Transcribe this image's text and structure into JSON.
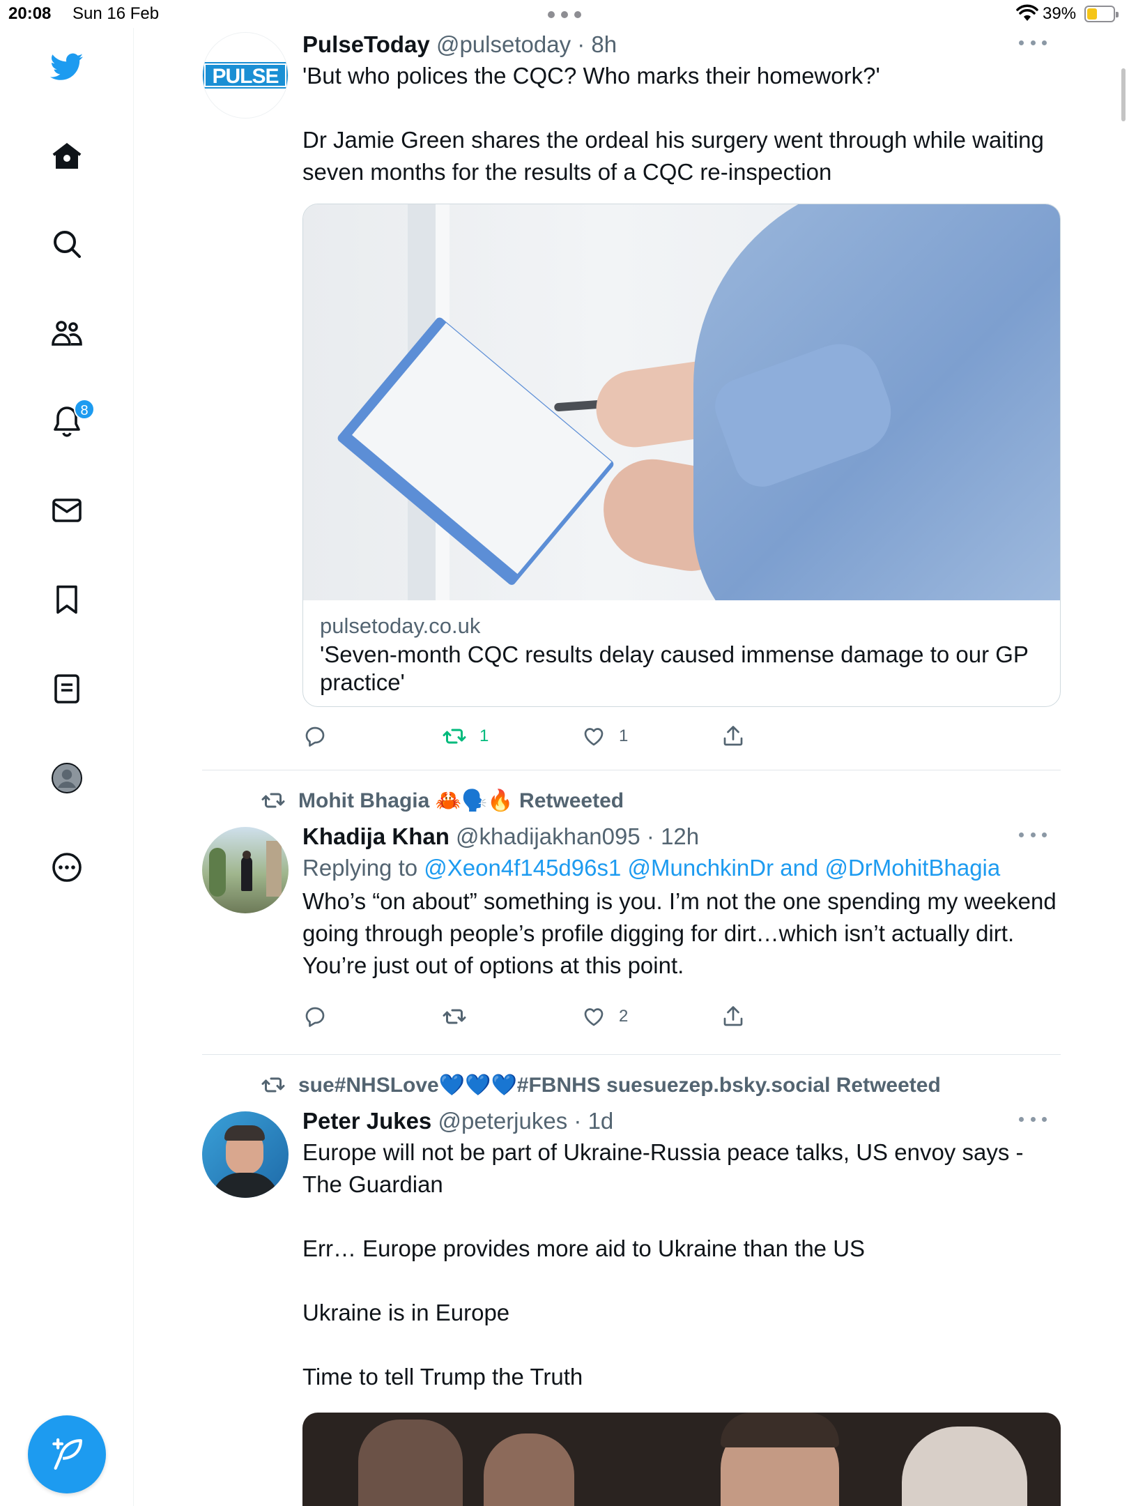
{
  "status_bar": {
    "time": "20:08",
    "date": "Sun 16 Feb",
    "battery": "39%",
    "battery_level": 0.39
  },
  "sidebar": {
    "items": [
      {
        "icon": "twitter-bird-icon"
      },
      {
        "icon": "home-icon"
      },
      {
        "icon": "search-icon"
      },
      {
        "icon": "communities-icon"
      },
      {
        "icon": "notifications-bell-icon",
        "badge": "8"
      },
      {
        "icon": "messages-mail-icon"
      },
      {
        "icon": "bookmarks-icon"
      },
      {
        "icon": "lists-icon"
      },
      {
        "icon": "profile-avatar-icon"
      },
      {
        "icon": "more-circle-icon"
      }
    ],
    "compose_icon": "compose-feather-icon"
  },
  "colors": {
    "accent": "#1d9bf0",
    "retweet_active": "#00ba7c",
    "secondary_text": "#536471",
    "primary_text": "#0f1419"
  },
  "tweets": [
    {
      "name": "PulseToday",
      "handle": "@pulsetoday",
      "time": "· 8h",
      "avatar_text": "PULSE",
      "text": "'But who polices the CQC? Who marks their homework?'\n\nDr Jamie Green shares the ordeal his surgery went through while waiting seven months for the results of a CQC re-inspection",
      "card": {
        "domain": "pulsetoday.co.uk",
        "title": "'Seven-month CQC results delay caused immense damage to our GP practice'"
      },
      "actions": {
        "reply": "",
        "retweet": "1",
        "like": "1"
      }
    },
    {
      "retweeted_by": "Mohit Bhagia 🦀🗣️🔥 Retweeted",
      "name": "Khadija Khan",
      "handle": "@khadijakhan095",
      "time": "· 12h",
      "replying_prefix": "Replying to",
      "replying_to": "@Xeon4f145d96s1 @MunchkinDr and @DrMohitBhagia",
      "text": "Who’s “on about” something is you. I’m not the one spending my weekend going through people’s profile digging for dirt…which isn’t actually dirt. You’re just out of options at this point.",
      "actions": {
        "reply": "",
        "retweet": "",
        "like": "2"
      }
    },
    {
      "retweeted_by": "sue#NHSLove💙💙💙#FBNHS suesuezep.bsky.social Retweeted",
      "name": "Peter Jukes",
      "handle": "@peterjukes",
      "time": "· 1d",
      "text": "Europe will not be part of Ukraine-Russia peace talks, US envoy says - The Guardian\n\nErr… Europe provides more aid to Ukraine than the US\n\nUkraine is in Europe\n\nTime to tell Trump the Truth"
    }
  ]
}
